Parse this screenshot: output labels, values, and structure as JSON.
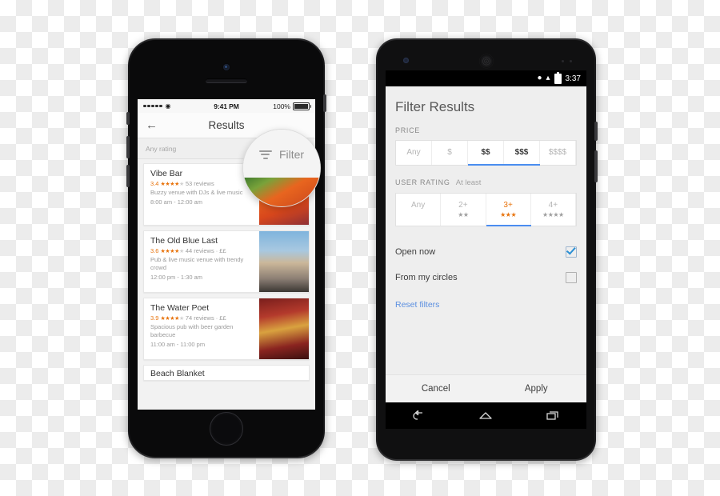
{
  "iphone": {
    "status": {
      "signal_dots": 5,
      "wifi_icon": "wifi-icon",
      "time": "9:41 PM",
      "battery_percent": "100%"
    },
    "nav": {
      "back_icon": "back-arrow-icon",
      "title": "Results"
    },
    "filter_bar": {
      "label": "Any rating"
    },
    "results": [
      {
        "name": "Vibe Bar",
        "score": "3.4",
        "stars_on": 4,
        "stars_off": 1,
        "reviews": "53 reviews",
        "price": "",
        "desc": "Buzzy venue with DJs & live music",
        "hours": "8:00 am - 12:00 am"
      },
      {
        "name": "The Old Blue Last",
        "score": "3.6",
        "stars_on": 4,
        "stars_off": 1,
        "reviews": "44 reviews",
        "price": "· ££",
        "desc": "Pub & live music venue with trendy crowd",
        "hours": "12:00 pm - 1:30 am"
      },
      {
        "name": "The Water Poet",
        "score": "3.9",
        "stars_on": 4,
        "stars_off": 1,
        "reviews": "74 reviews",
        "price": "· ££",
        "desc": "Spacious pub with beer garden barbecue",
        "hours": "11:00 am - 11:00 pm"
      },
      {
        "name": "Beach Blanket",
        "score": "",
        "stars_on": 0,
        "stars_off": 0,
        "reviews": "",
        "price": "",
        "desc": "",
        "hours": ""
      }
    ]
  },
  "magnifier": {
    "icon": "filter-icon",
    "label": "Filter"
  },
  "android": {
    "status": {
      "location_icon": "location-pin-icon",
      "wifi_icon": "wifi-icon",
      "battery_icon": "battery-icon",
      "time": "3:37"
    },
    "title": "Filter Results",
    "price": {
      "label": "PRICE",
      "options": [
        {
          "label": "Any",
          "state": "inactive"
        },
        {
          "label": "$",
          "state": "inactive"
        },
        {
          "label": "$$",
          "state": "selected"
        },
        {
          "label": "$$$",
          "state": "selected"
        },
        {
          "label": "$$$$",
          "state": "inactive"
        }
      ]
    },
    "user_rating": {
      "label": "USER RATING",
      "sub_label": "At least",
      "options": [
        {
          "label": "Any",
          "stars": "",
          "state": "inactive"
        },
        {
          "label": "2+",
          "stars": "★★",
          "state": "inactive"
        },
        {
          "label": "3+",
          "stars": "★★★",
          "state": "selected"
        },
        {
          "label": "4+",
          "stars": "★★★★",
          "state": "inactive"
        }
      ]
    },
    "toggles": [
      {
        "label": "Open now",
        "checked": true
      },
      {
        "label": "From my circles",
        "checked": false
      }
    ],
    "reset_label": "Reset filters",
    "actions": {
      "cancel": "Cancel",
      "apply": "Apply"
    },
    "navbar": {
      "back_icon": "android-back-icon",
      "home_icon": "android-home-icon",
      "recents_icon": "android-recents-icon"
    }
  },
  "colors": {
    "accent_blue": "#4a8df0",
    "accent_orange": "#e8730c",
    "link_blue": "#5b8fe0",
    "check_blue": "#2a8fd4"
  }
}
